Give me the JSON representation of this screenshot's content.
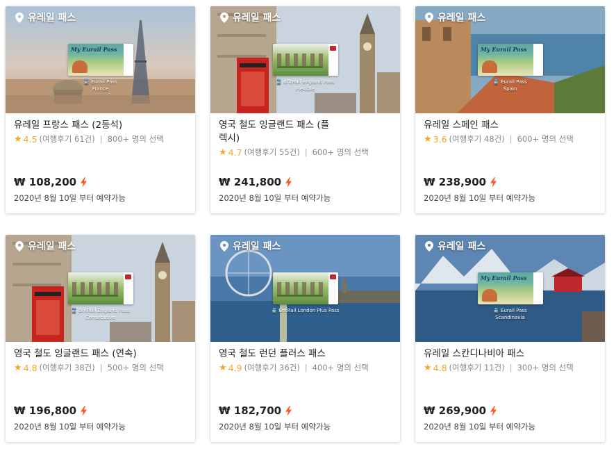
{
  "colors": {
    "rating_star": "#f5a623",
    "instant_bolt": "#ff5722",
    "text_primary": "#222222",
    "text_secondary": "#888888"
  },
  "products": [
    {
      "provider": "유레일 패스",
      "image_type": "paris",
      "pass_brand": "My Eurail Pass",
      "pass_name": "Eurail Pass",
      "pass_region": "France",
      "title": "유레일 프랑스 패스 (2등석)",
      "rating": "4.5",
      "reviews": "(여행후기 61건)",
      "bookings": "800+ 명의 선택",
      "price": "₩ 108,200",
      "availability": "2020년 8월 10일 부터 예약가능"
    },
    {
      "provider": "유레일 패스",
      "image_type": "london_bigben",
      "pass_brand": "",
      "pass_name": "BritRail England Pass",
      "pass_region": "Flexible",
      "title": "영국 철도 잉글랜드 패스 (플렉시)",
      "rating": "4.7",
      "reviews": "(여행후기 55건)",
      "bookings": "600+ 명의 선택",
      "price": "₩ 241,800",
      "availability": "2020년 8월 10일 부터 예약가능"
    },
    {
      "provider": "유레일 패스",
      "image_type": "spain",
      "pass_brand": "My Eurail Pass",
      "pass_name": "Eurail Pass",
      "pass_region": "Spain",
      "title": "유레일 스페인 패스",
      "rating": "3.6",
      "reviews": "(여행후기 48건)",
      "bookings": "600+ 명의 선택",
      "price": "₩ 238,900",
      "availability": "2020년 8월 10일 부터 예약가능"
    },
    {
      "provider": "유레일 패스",
      "image_type": "london_bigben",
      "pass_brand": "",
      "pass_name": "BritRail England Pass",
      "pass_region": "Consecutive",
      "title": "영국 철도 잉글랜드 패스 (연속)",
      "rating": "4.8",
      "reviews": "(여행후기 38건)",
      "bookings": "500+ 명의 선택",
      "price": "₩ 196,800",
      "availability": "2020년 8월 10일 부터 예약가능"
    },
    {
      "provider": "유레일 패스",
      "image_type": "london_eye",
      "pass_brand": "",
      "pass_name": "BritRail London Plus Pass",
      "pass_region": "",
      "title": "영국 철도 런던 플러스 패스",
      "rating": "4.9",
      "reviews": "(여행후기 36건)",
      "bookings": "400+ 명의 선택",
      "price": "₩ 182,700",
      "availability": "2020년 8월 10일 부터 예약가능"
    },
    {
      "provider": "유레일 패스",
      "image_type": "scandinavia",
      "pass_brand": "My Eurail Pass",
      "pass_name": "Eurail Pass",
      "pass_region": "Scandinavia",
      "title": "유레일 스칸디나비아 패스",
      "rating": "4.8",
      "reviews": "(여행후기 11건)",
      "bookings": "300+ 명의 선택",
      "price": "₩ 269,900",
      "availability": "2020년 8월 10일 부터 예약가능"
    }
  ]
}
